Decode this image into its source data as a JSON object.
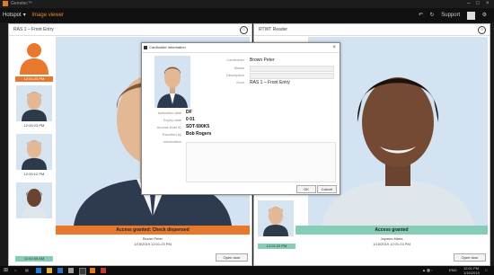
{
  "window": {
    "title": "Genetec™"
  },
  "menu": {
    "home": "Hotspot",
    "module": "Image viewer",
    "support": "Support"
  },
  "left_pane": {
    "title": "RAS 1 – Front Entry",
    "thumbnails": [
      {
        "kind": "silhouette",
        "time": "12:01:23 PM",
        "color": "#e8782b"
      },
      {
        "kind": "photo",
        "time": "12:00:23 PM"
      },
      {
        "kind": "photo",
        "time": "12:00:12 PM"
      },
      {
        "kind": "photo",
        "time": "11:43:45 AM"
      }
    ],
    "status": {
      "text": "Access granted: Check dispensed",
      "color": "#e8782b"
    },
    "info_name": "Brown Peter",
    "info_time": "1/15/2019 12:01:23 PM",
    "button": "Open door"
  },
  "right_pane": {
    "title": "RTWT Reader",
    "thumbnail_time": "12:01:23 PM",
    "status": {
      "text": "Access granted",
      "color": "#86cdb8"
    },
    "info_name": "Jaymes Maria",
    "info_time": "1/15/2019 12:01:23 PM",
    "button": "Open door"
  },
  "dialog": {
    "title": "Cardholder information",
    "close": "×",
    "fields": [
      {
        "label": "Cardholder",
        "value": "Brown Peter"
      },
      {
        "label": "Status",
        "value": ""
      },
      {
        "label": "Description",
        "value": ""
      },
      {
        "label": "Door",
        "value": "RAS 1 – Front Entry"
      }
    ],
    "details": [
      {
        "label": "Activation date",
        "value": "DF"
      },
      {
        "label": "Expiry date",
        "value": "0 01"
      },
      {
        "label": "Access level ID",
        "value": "SDT-590K5"
      },
      {
        "label": "Escorted by",
        "value": "Bob Rogers"
      },
      {
        "label": "Information",
        "value": ""
      }
    ],
    "ok": "OK",
    "cancel": "Cancel"
  },
  "taskbar": {
    "time": "12:01 PM",
    "date": "1/15/2019",
    "lang": "ENG"
  }
}
